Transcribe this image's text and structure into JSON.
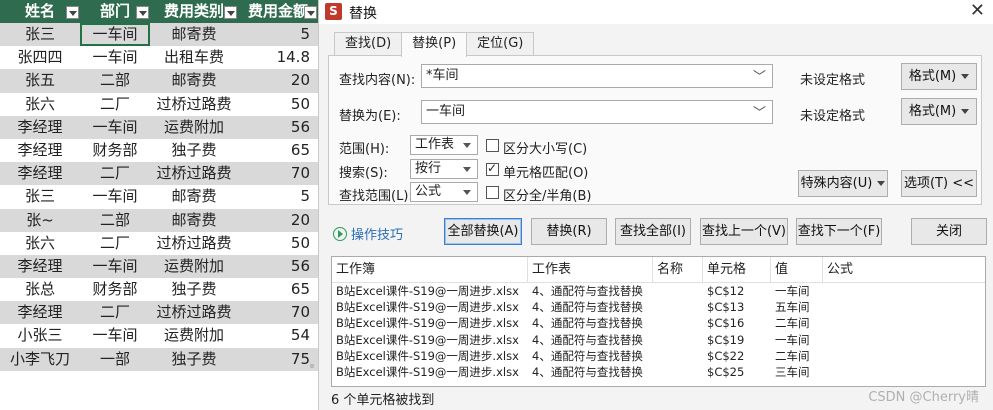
{
  "sheet": {
    "headers": [
      "姓名",
      "部门",
      "费用类别",
      "费用金额"
    ],
    "rows": [
      [
        "张三",
        "一车间",
        "邮寄费",
        "5"
      ],
      [
        "张四四",
        "一车间",
        "出租车费",
        "14.8"
      ],
      [
        "张五",
        "二部",
        "邮寄费",
        "20"
      ],
      [
        "张六",
        "二厂",
        "过桥过路费",
        "50"
      ],
      [
        "李经理",
        "一车间",
        "运费附加",
        "56"
      ],
      [
        "李经理",
        "财务部",
        "独子费",
        "65"
      ],
      [
        "李经理",
        "二厂",
        "过桥过路费",
        "70"
      ],
      [
        "张三",
        "一车间",
        "邮寄费",
        "5"
      ],
      [
        "张~",
        "二部",
        "邮寄费",
        "20"
      ],
      [
        "张六",
        "二厂",
        "过桥过路费",
        "50"
      ],
      [
        "李经理",
        "一车间",
        "运费附加",
        "56"
      ],
      [
        "张总",
        "财务部",
        "独子费",
        "65"
      ],
      [
        "李经理",
        "二厂",
        "过桥过路费",
        "70"
      ],
      [
        "小张三",
        "一车间",
        "运费附加",
        "54"
      ],
      [
        "小李飞刀",
        "一部",
        "独子费",
        "75"
      ]
    ],
    "colors": {
      "header_bg": "#2f6b4f",
      "band_bg": "#d9d9d9",
      "selection": "#217346"
    }
  },
  "dialog": {
    "app_icon": "S",
    "title": "替换",
    "close": "✕",
    "tabs": [
      "查找(D)",
      "替换(P)",
      "定位(G)"
    ],
    "find_label": "查找内容(N):",
    "find_value": "*车间",
    "replace_label": "替换为(E):",
    "replace_value": "一车间",
    "no_format_1": "未设定格式",
    "no_format_2": "未设定格式",
    "format_btn_1": "格式(M)",
    "format_btn_2": "格式(M)",
    "scope_label": "范围(H):",
    "scope_value": "工作表",
    "search_label": "搜索(S):",
    "search_value": "按行",
    "lookin_label": "查找范围(L):",
    "lookin_value": "公式",
    "case_label": "区分大小写(C)",
    "cell_match_label": "单元格匹配(O)",
    "width_label": "区分全/半角(B)",
    "special_btn": "特殊内容(U)",
    "options_btn": "选项(T) <<",
    "tips_label": "操作技巧",
    "replace_all_btn": "全部替换(A)",
    "replace_btn": "替换(R)",
    "find_all_btn": "查找全部(I)",
    "find_prev_btn": "查找上一个(V)",
    "find_next_btn": "查找下一个(F)",
    "close_btn": "关闭",
    "results_headers": [
      "工作簿",
      "工作表",
      "名称",
      "单元格",
      "值",
      "公式"
    ],
    "results": [
      [
        "B站Excel课件-S19@一周进步.xlsx",
        "4、通配符与查找替换",
        "",
        "$C$12",
        "一车间",
        ""
      ],
      [
        "B站Excel课件-S19@一周进步.xlsx",
        "4、通配符与查找替换",
        "",
        "$C$13",
        "五车间",
        ""
      ],
      [
        "B站Excel课件-S19@一周进步.xlsx",
        "4、通配符与查找替换",
        "",
        "$C$16",
        "二车间",
        ""
      ],
      [
        "B站Excel课件-S19@一周进步.xlsx",
        "4、通配符与查找替换",
        "",
        "$C$19",
        "一车间",
        ""
      ],
      [
        "B站Excel课件-S19@一周进步.xlsx",
        "4、通配符与查找替换",
        "",
        "$C$22",
        "二车间",
        ""
      ],
      [
        "B站Excel课件-S19@一周进步.xlsx",
        "4、通配符与查找替换",
        "",
        "$C$25",
        "三车间",
        ""
      ]
    ],
    "status": "6 个单元格被找到",
    "colors": {
      "accent": "#3c7fd0",
      "tips": "#2a6db5",
      "app_icon": "#c0392b"
    }
  },
  "watermark": "CSDN @Cherry晴"
}
